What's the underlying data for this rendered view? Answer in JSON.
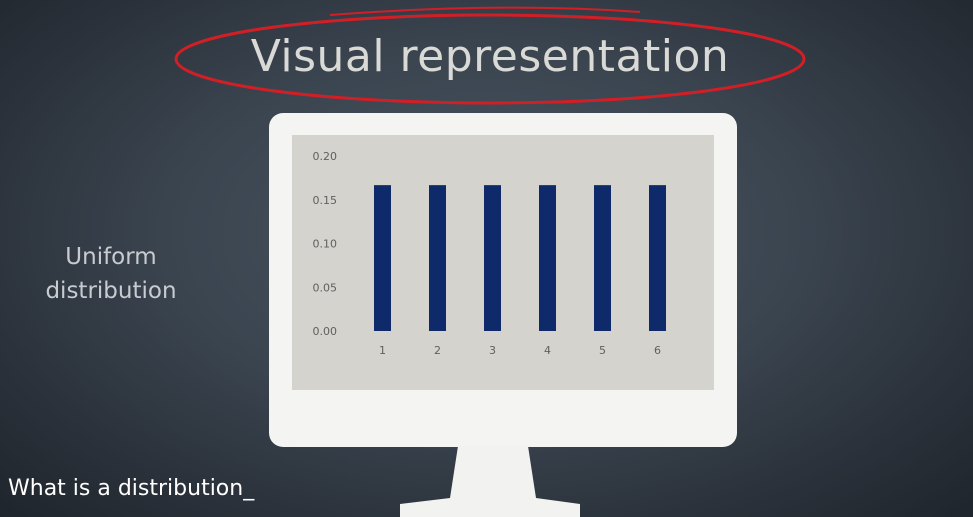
{
  "slide": {
    "title": "Visual representation",
    "side_label": "Uniform distribution",
    "caption": "What is a distribution_"
  },
  "colors": {
    "bar": "#0e2a6a",
    "highlight_circle": "#d21f26"
  },
  "chart_data": {
    "type": "bar",
    "categories": [
      "1",
      "2",
      "3",
      "4",
      "5",
      "6"
    ],
    "values": [
      0.1667,
      0.1667,
      0.1667,
      0.1667,
      0.1667,
      0.1667
    ],
    "title": "",
    "xlabel": "",
    "ylabel": "",
    "ylim": [
      0,
      0.2
    ],
    "yticks": [
      "0.00",
      "0.05",
      "0.10",
      "0.15",
      "0.20"
    ],
    "grid": false,
    "legend": "none"
  }
}
